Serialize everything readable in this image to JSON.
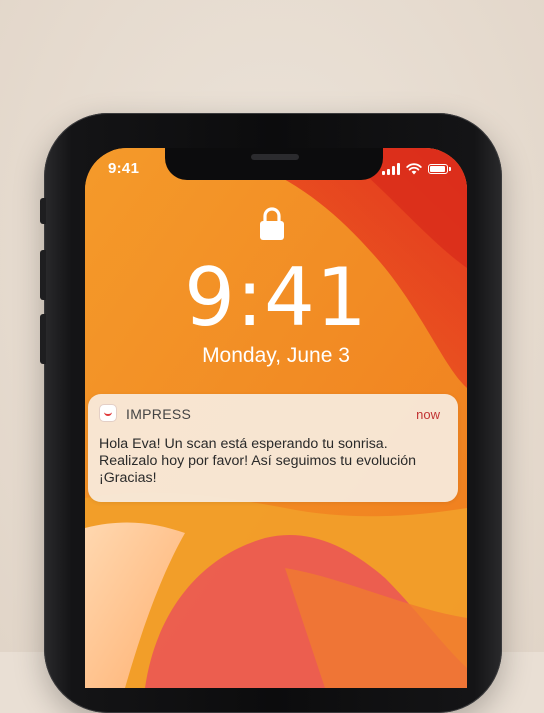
{
  "status_bar": {
    "time": "9:41"
  },
  "lock_screen": {
    "time": "9:41",
    "date": "Monday, June 3",
    "lock_icon": "lock-icon"
  },
  "notification": {
    "app_name": "IMPRESS",
    "time": "now",
    "app_icon": "impress-smile-icon",
    "lines": [
      "Hola Eva! Un scan está esperando tu sonrisa.",
      "Realizalo hoy por favor! Así seguimos tu evolución",
      "¡Gracias!"
    ]
  },
  "colors": {
    "accent": "#c23434",
    "wallpaper_primary": "#f08a22",
    "wallpaper_secondary": "#e3352a"
  }
}
